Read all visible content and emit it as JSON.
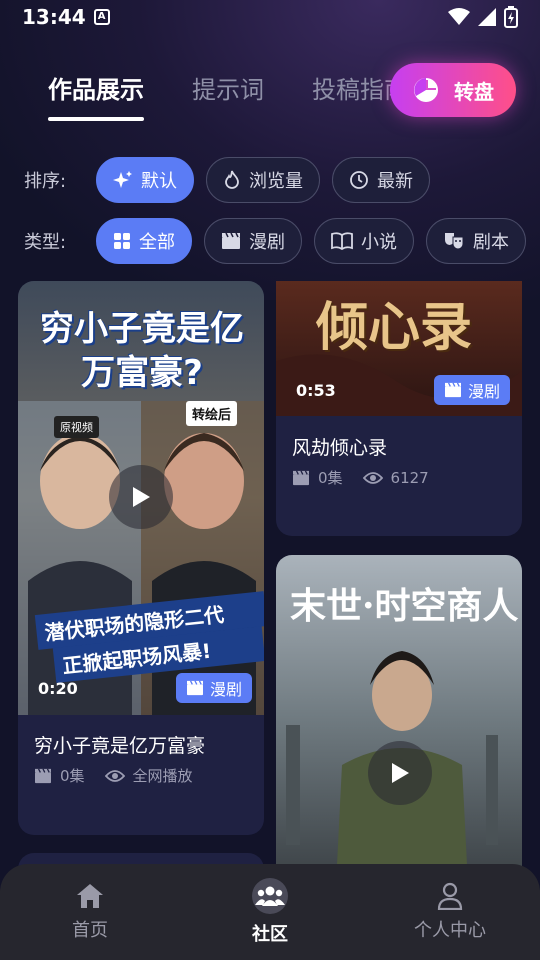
{
  "status_bar": {
    "time": "13:44",
    "badge": "A"
  },
  "tabs": [
    {
      "label": "作品展示",
      "active": true
    },
    {
      "label": "提示词",
      "active": false
    },
    {
      "label": "投稿指南",
      "active": false
    }
  ],
  "wheel_button": {
    "label": "转盘"
  },
  "sort": {
    "label": "排序:",
    "options": [
      {
        "label": "默认",
        "icon": "sparkle-icon",
        "active": true
      },
      {
        "label": "浏览量",
        "icon": "flame-icon",
        "active": false
      },
      {
        "label": "最新",
        "icon": "clock-icon",
        "active": false
      }
    ]
  },
  "category": {
    "label": "类型:",
    "options": [
      {
        "label": "全部",
        "icon": "grid-icon",
        "active": true
      },
      {
        "label": "漫剧",
        "icon": "clapperboard-icon",
        "active": false
      },
      {
        "label": "小说",
        "icon": "book-icon",
        "active": false
      },
      {
        "label": "剧本",
        "icon": "masks-icon",
        "active": false
      }
    ]
  },
  "cards": [
    {
      "title": "穷小子竟是亿万富豪",
      "duration": "0:20",
      "type": "漫剧",
      "episodes": "0集",
      "views": "全网播放",
      "poster_headline": "穷小子竟是亿万富豪?",
      "poster_tag_left": "原视频",
      "poster_tag_right": "转绘后",
      "poster_slogan_1": "潜伏职场的隐形二代",
      "poster_slogan_2": "正掀起职场风暴!"
    },
    {
      "title": "风劫倾心录",
      "duration": "0:53",
      "type": "漫剧",
      "episodes": "0集",
      "views": "6127",
      "poster_headline": "倾心录"
    },
    {
      "poster_headline": "末世·时空商人"
    }
  ],
  "bottom_nav": [
    {
      "label": "首页",
      "icon": "home-icon",
      "active": false
    },
    {
      "label": "社区",
      "icon": "community-icon",
      "active": true
    },
    {
      "label": "个人中心",
      "icon": "user-icon",
      "active": false
    }
  ],
  "colors": {
    "accent": "#5b7cf5",
    "wheel_gradient_start": "#c63ff0",
    "wheel_gradient_end": "#ff4f88",
    "background": "#121329"
  }
}
